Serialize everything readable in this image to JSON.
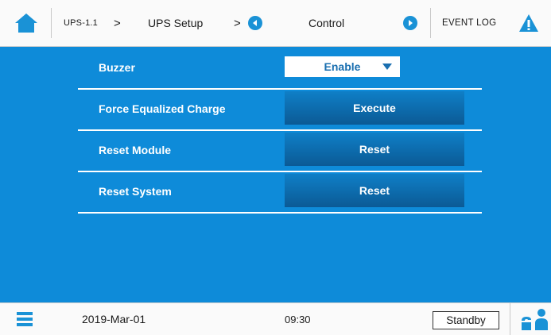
{
  "topbar": {
    "breadcrumb_device": "UPS-1.1",
    "breadcrumb_setup": "UPS Setup",
    "separator": ">",
    "section_label": "Control",
    "event_log_label": "EVENT LOG"
  },
  "icons": {
    "home": "home-icon",
    "prev": "arrow-left-circle-icon",
    "next": "arrow-right-circle-icon",
    "warning": "warning-icon",
    "menu": "menu-icon",
    "users": "users-icon"
  },
  "colors": {
    "panel_bg": "#0e8bd9",
    "accent": "#1a92d6",
    "button_dark": "#0b5a95"
  },
  "controls": {
    "buzzer": {
      "label": "Buzzer",
      "value": "Enable"
    },
    "force_equalized_charge": {
      "label": "Force Equalized Charge",
      "button": "Execute"
    },
    "reset_module": {
      "label": "Reset Module",
      "button": "Reset"
    },
    "reset_system": {
      "label": "Reset System",
      "button": "Reset"
    }
  },
  "bottombar": {
    "date": "2019-Mar-01",
    "time": "09:30",
    "status": "Standby"
  }
}
